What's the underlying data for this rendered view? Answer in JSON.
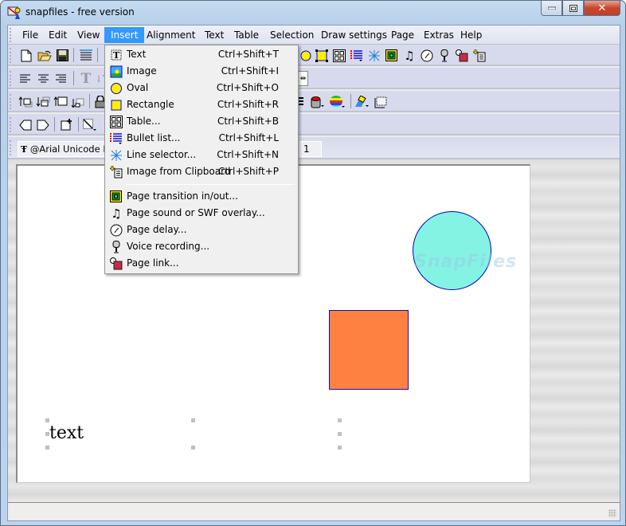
{
  "window": {
    "title": "snapfiles - free version",
    "buttons": {
      "minimize": "minimize",
      "maximize": "maximize",
      "close": "close"
    }
  },
  "menubar": {
    "items": [
      {
        "label": "File"
      },
      {
        "label": "Edit"
      },
      {
        "label": "View"
      },
      {
        "label": "Insert",
        "active": true
      },
      {
        "label": "Alignment"
      },
      {
        "label": "Text"
      },
      {
        "label": "Table"
      },
      {
        "label": "Selection"
      },
      {
        "label": "Draw settings"
      },
      {
        "label": "Page"
      },
      {
        "label": "Extras"
      },
      {
        "label": "Help"
      }
    ]
  },
  "toolbar": {
    "font_name": "@Arial Unicode MS",
    "page_number": "1",
    "row1_icons": [
      "new-file-icon",
      "open-folder-icon",
      "save-icon",
      "text-layout-icon"
    ],
    "row1_right_icons": [
      "oval-icon",
      "rectangle-icon",
      "table-icon",
      "bullet-list-icon",
      "line-selector-icon",
      "page-transition-icon",
      "page-sound-icon",
      "page-delay-icon",
      "voice-recording-icon",
      "page-link-icon",
      "image-from-clipboard-icon"
    ],
    "row2_icons": [
      "align-left-icon",
      "align-center-icon",
      "align-right-icon",
      "text-size-up-icon",
      "text-size-down-icon"
    ],
    "row3_icons": [
      "bring-forward-icon",
      "send-backward-icon",
      "bring-to-front-icon",
      "send-to-back-icon",
      "lock-icon"
    ],
    "row3_right_icons": [
      "line-style-icon",
      "fill-color-icon",
      "color-palette-icon",
      "fill-bucket-icon",
      "shadow-icon"
    ],
    "row4_icons": [
      "previous-page-icon",
      "next-page-icon",
      "new-page-icon",
      "line-tool-icon"
    ]
  },
  "insert_menu": {
    "items": [
      {
        "icon": "text-icon",
        "label": "Text",
        "shortcut": "Ctrl+Shift+T"
      },
      {
        "icon": "image-icon",
        "label": "Image",
        "shortcut": "Ctrl+Shift+I"
      },
      {
        "icon": "oval-icon",
        "label": "Oval",
        "shortcut": "Ctrl+Shift+O"
      },
      {
        "icon": "rectangle-icon",
        "label": "Rectangle",
        "shortcut": "Ctrl+Shift+R"
      },
      {
        "icon": "table-icon",
        "label": "Table...",
        "shortcut": "Ctrl+Shift+B"
      },
      {
        "icon": "bullet-list-icon",
        "label": "Bullet list...",
        "shortcut": "Ctrl+Shift+L"
      },
      {
        "icon": "line-selector-icon",
        "label": "Line selector...",
        "shortcut": "Ctrl+Shift+N"
      },
      {
        "icon": "image-from-clipboard-icon",
        "label": "Image from Clipboard",
        "shortcut": "Ctrl+Shift+P"
      }
    ],
    "items2": [
      {
        "icon": "page-transition-icon",
        "label": "Page transition in/out..."
      },
      {
        "icon": "page-sound-icon",
        "label": "Page sound or SWF overlay..."
      },
      {
        "icon": "page-delay-icon",
        "label": "Page delay..."
      },
      {
        "icon": "voice-recording-icon",
        "label": "Voice recording..."
      },
      {
        "icon": "page-link-icon",
        "label": "Page link..."
      }
    ]
  },
  "canvas": {
    "text_object": "text",
    "watermark": "SnapFiles",
    "colors": {
      "circle_fill": "#84f3e4",
      "shape_border": "#0000cc",
      "rect_fill": "#fe8141"
    }
  }
}
